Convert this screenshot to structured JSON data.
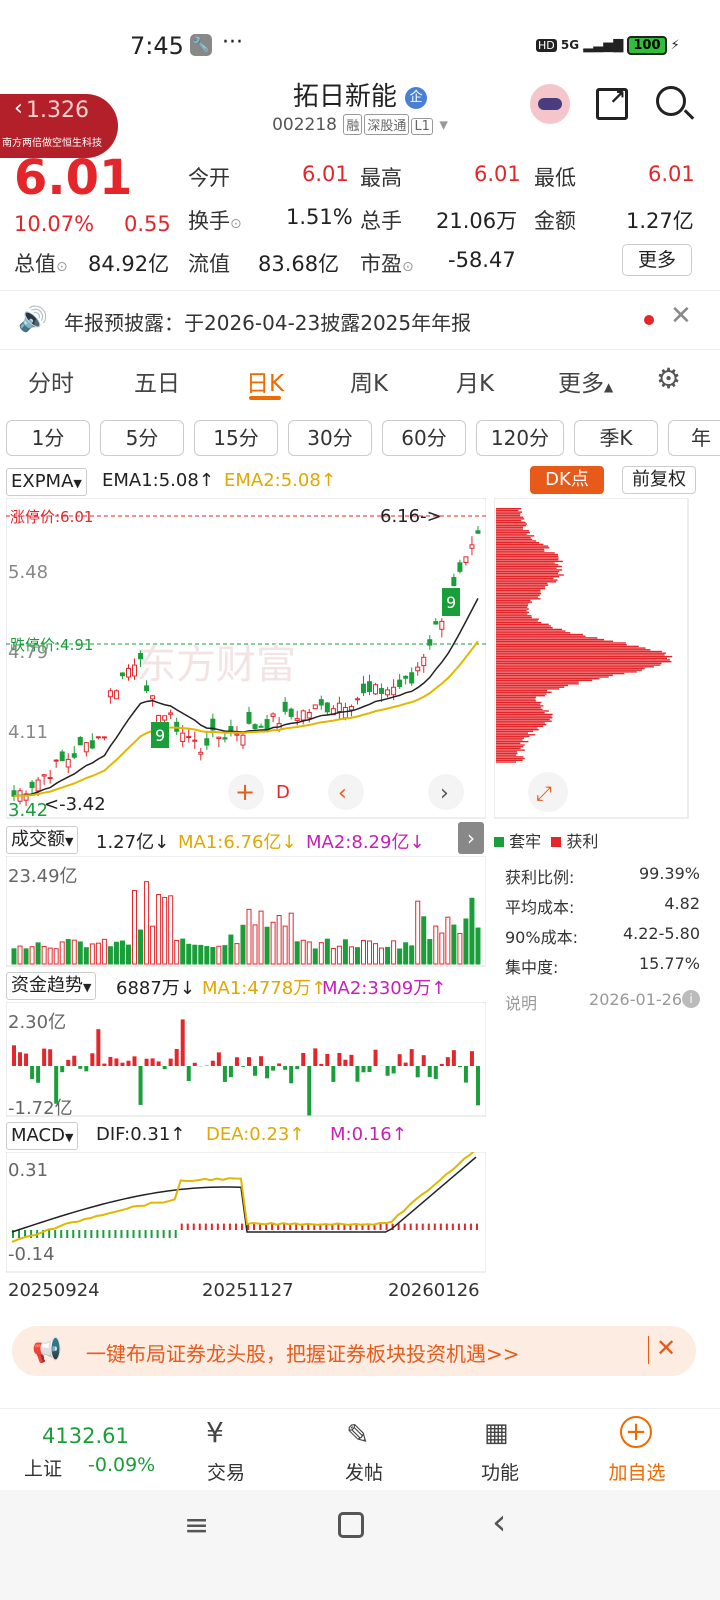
{
  "status": {
    "time": "7:45",
    "battery": "100",
    "signal": "5G"
  },
  "header": {
    "title": "拓日新能",
    "code": "002218",
    "tags": [
      "融",
      "深股通",
      "L1"
    ]
  },
  "bubble": {
    "value": "1.326",
    "label": "南方两倍做空恒生科技"
  },
  "quote": {
    "price": "6.01",
    "pct": "10.07%",
    "change": "0.55",
    "rows": [
      [
        "今开",
        "6.01",
        "最高",
        "6.01",
        "最低",
        "6.01"
      ],
      [
        "换手",
        "1.51%",
        "总手",
        "21.06万",
        "金额",
        "1.27亿"
      ]
    ],
    "cap_label": "总值",
    "cap": "84.92亿",
    "float_label": "流值",
    "float": "83.68亿",
    "pe_label": "市盈",
    "pe": "-58.47",
    "more": "更多"
  },
  "notice": {
    "text": "年报预披露：于2026-04-23披露2025年年报"
  },
  "tabs": [
    "分时",
    "五日",
    "日K",
    "周K",
    "月K",
    "更多"
  ],
  "intervals": [
    "1分",
    "5分",
    "15分",
    "30分",
    "60分",
    "120分",
    "季K",
    "年"
  ],
  "kline": {
    "indicator": "EXPMA",
    "ema1": "EMA1:5.08",
    "ema2": "EMA2:5.08",
    "dk": "DK点",
    "adj": "前复权",
    "limit_up": "涨停价:6.01",
    "limit_down": "跌停价:4.91",
    "high_mark": "6.16->",
    "low_mark": "<-3.42",
    "y_labels": [
      "5.48",
      "4.79",
      "4.11"
    ],
    "low_tick": "3.42",
    "watermark": "东方财富"
  },
  "volume": {
    "label": "成交额",
    "value": "1.27亿",
    "ma1": "MA1:6.76亿",
    "ma2": "MA2:8.29亿",
    "top": "23.49亿"
  },
  "fund": {
    "label": "资金趋势",
    "value": "6887万",
    "ma1": "MA1:4778万",
    "ma2": "MA2:3309万",
    "top": "2.30亿",
    "bottom": "-1.72亿"
  },
  "macd": {
    "label": "MACD",
    "dif": "DIF:0.31",
    "dea": "DEA:0.23",
    "m": "M:0.16",
    "top": "0.31",
    "bottom": "-0.14",
    "dates": [
      "20250924",
      "20251127",
      "20260126"
    ]
  },
  "chip": {
    "legend_trapped": "套牢",
    "legend_profit": "获利",
    "stats": [
      [
        "获利比例:",
        "99.39%"
      ],
      [
        "平均成本:",
        "4.82"
      ],
      [
        "90%成本:",
        "4.22-5.80"
      ],
      [
        "集中度:",
        "15.77%"
      ]
    ],
    "note": "说明",
    "date": "2026-01-26"
  },
  "banner": {
    "text": "一键布局证券龙头股，把握证券板块投资机遇>>"
  },
  "bottom": {
    "index_value": "4132.61",
    "index_name": "上证",
    "index_pct": "-0.09%",
    "items": [
      "交易",
      "发帖",
      "功能",
      "加自选"
    ]
  },
  "colors": {
    "up": "#e4262b",
    "down": "#1a9e3a",
    "accent": "#f06a00"
  }
}
